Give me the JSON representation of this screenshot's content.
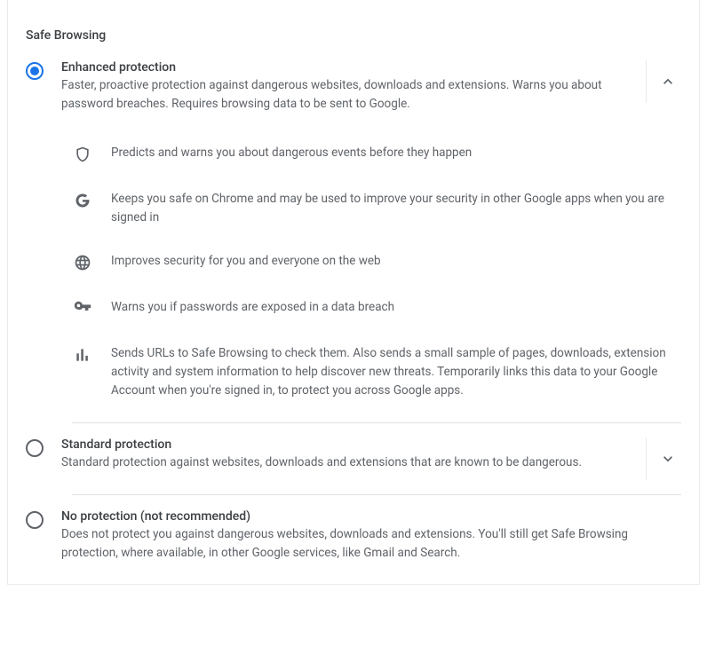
{
  "section": {
    "title": "Safe Browsing",
    "options": [
      {
        "id": "enhanced",
        "selected": true,
        "expanded": true,
        "title": "Enhanced protection",
        "description": "Faster, proactive protection against dangerous websites, downloads and extensions. Warns you about password breaches. Requires browsing data to be sent to Google.",
        "details": [
          {
            "icon": "shield-icon",
            "text": "Predicts and warns you about dangerous events before they happen"
          },
          {
            "icon": "google-icon",
            "text": "Keeps you safe on Chrome and may be used to improve your security in other Google apps when you are signed in"
          },
          {
            "icon": "globe-icon",
            "text": "Improves security for you and everyone on the web"
          },
          {
            "icon": "key-icon",
            "text": "Warns you if passwords are exposed in a data breach"
          },
          {
            "icon": "bars-icon",
            "text": "Sends URLs to Safe Browsing to check them. Also sends a small sample of pages, downloads, extension activity and system information to help discover new threats. Temporarily links this data to your Google Account when you're signed in, to protect you across Google apps."
          }
        ]
      },
      {
        "id": "standard",
        "selected": false,
        "expanded": false,
        "title": "Standard protection",
        "description": "Standard protection against websites, downloads and extensions that are known to be dangerous."
      },
      {
        "id": "none",
        "selected": false,
        "expanded": null,
        "title": "No protection (not recommended)",
        "description": "Does not protect you against dangerous websites, downloads and extensions. You'll still get Safe Browsing protection, where available, in other Google services, like Gmail and Search."
      }
    ]
  }
}
